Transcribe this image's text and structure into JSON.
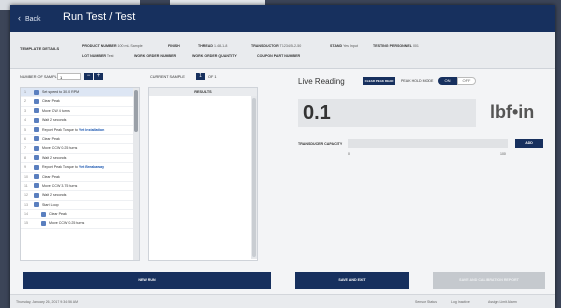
{
  "window": {
    "back_label": "Back",
    "title": "Run Test / Test"
  },
  "template": {
    "heading": "TEMPLATE DETAILS",
    "fields": [
      {
        "label": "PRODUCT NUMBER",
        "value": "100 mL Sample"
      },
      {
        "label": "FINISH",
        "value": ""
      },
      {
        "label": "THREAD",
        "value": "1.48-1-8"
      },
      {
        "label": "TRANSDUCTOR",
        "value": "T1234/5-2-50"
      },
      {
        "label": "STAND",
        "value": "Yes Input"
      },
      {
        "label": "TESTING PERSONNEL",
        "value": "001"
      },
      {
        "label": "LOT NUMBER",
        "value": "Test"
      },
      {
        "label": "WORK ORDER NUMBER",
        "value": ""
      },
      {
        "label": "WORK ORDER QUANTITY",
        "value": ""
      },
      {
        "label": "COUPON PART NUMBER",
        "value": ""
      }
    ]
  },
  "samples": {
    "label": "NUMBER OF SAMPLES",
    "value": "1",
    "minus": "−",
    "plus": "+",
    "steps": [
      {
        "num": "1",
        "pre": "Set speed to 30.0 RPM",
        "bold": ""
      },
      {
        "num": "2",
        "pre": "Clear Peak",
        "bold": ""
      },
      {
        "num": "3",
        "pre": "Move CW 4 turns",
        "bold": ""
      },
      {
        "num": "4",
        "pre": "Wait 2 seconds",
        "bold": ""
      },
      {
        "num": "5",
        "pre": "Report Peak Torque to ",
        "bold": "Yet Installation"
      },
      {
        "num": "6",
        "pre": "Clear Peak",
        "bold": ""
      },
      {
        "num": "7",
        "pre": "Move CCW 0.25 turns",
        "bold": ""
      },
      {
        "num": "8",
        "pre": "Wait 2 seconds",
        "bold": ""
      },
      {
        "num": "9",
        "pre": "Report Peak Torque to ",
        "bold": "Yet Breakaway"
      },
      {
        "num": "10",
        "pre": "Clear Peak",
        "bold": ""
      },
      {
        "num": "11",
        "pre": "Move CCW 3.75 turns",
        "bold": ""
      },
      {
        "num": "12",
        "pre": "Wait 2 seconds",
        "bold": ""
      },
      {
        "num": "13",
        "pre": "Start Loop",
        "bold": ""
      },
      {
        "num": "14",
        "pre": "Clear Peak",
        "bold": ""
      },
      {
        "num": "15",
        "pre": "Move CCW 0.25 turns",
        "bold": ""
      }
    ]
  },
  "current": {
    "label": "CURRENT SAMPLE",
    "value": "1",
    "of": "OF 1",
    "results_heading": "RESULTS"
  },
  "live": {
    "title": "Live Reading",
    "calibrate": "CLEAR PEAK READ",
    "peak_mode": "PEAK HOLD MODE",
    "on": "ON",
    "off": "OFF",
    "value": "0.1",
    "unit": "lbf•in",
    "capacity_label": "TRANSDUCER CAPACITY",
    "tick_min": "0",
    "tick_max": "100",
    "add": "ADD"
  },
  "actions": {
    "start": "NEW RUN",
    "save": "SAVE AND EXIT",
    "disabled": "SAVE AND CALIBRATION REPORT"
  },
  "footer": {
    "date": "Thursday, January 26, 2017 9:34:56 AM",
    "links": [
      "Sensor Status",
      "Log Inactive",
      "Assign Limit Alarm"
    ]
  }
}
